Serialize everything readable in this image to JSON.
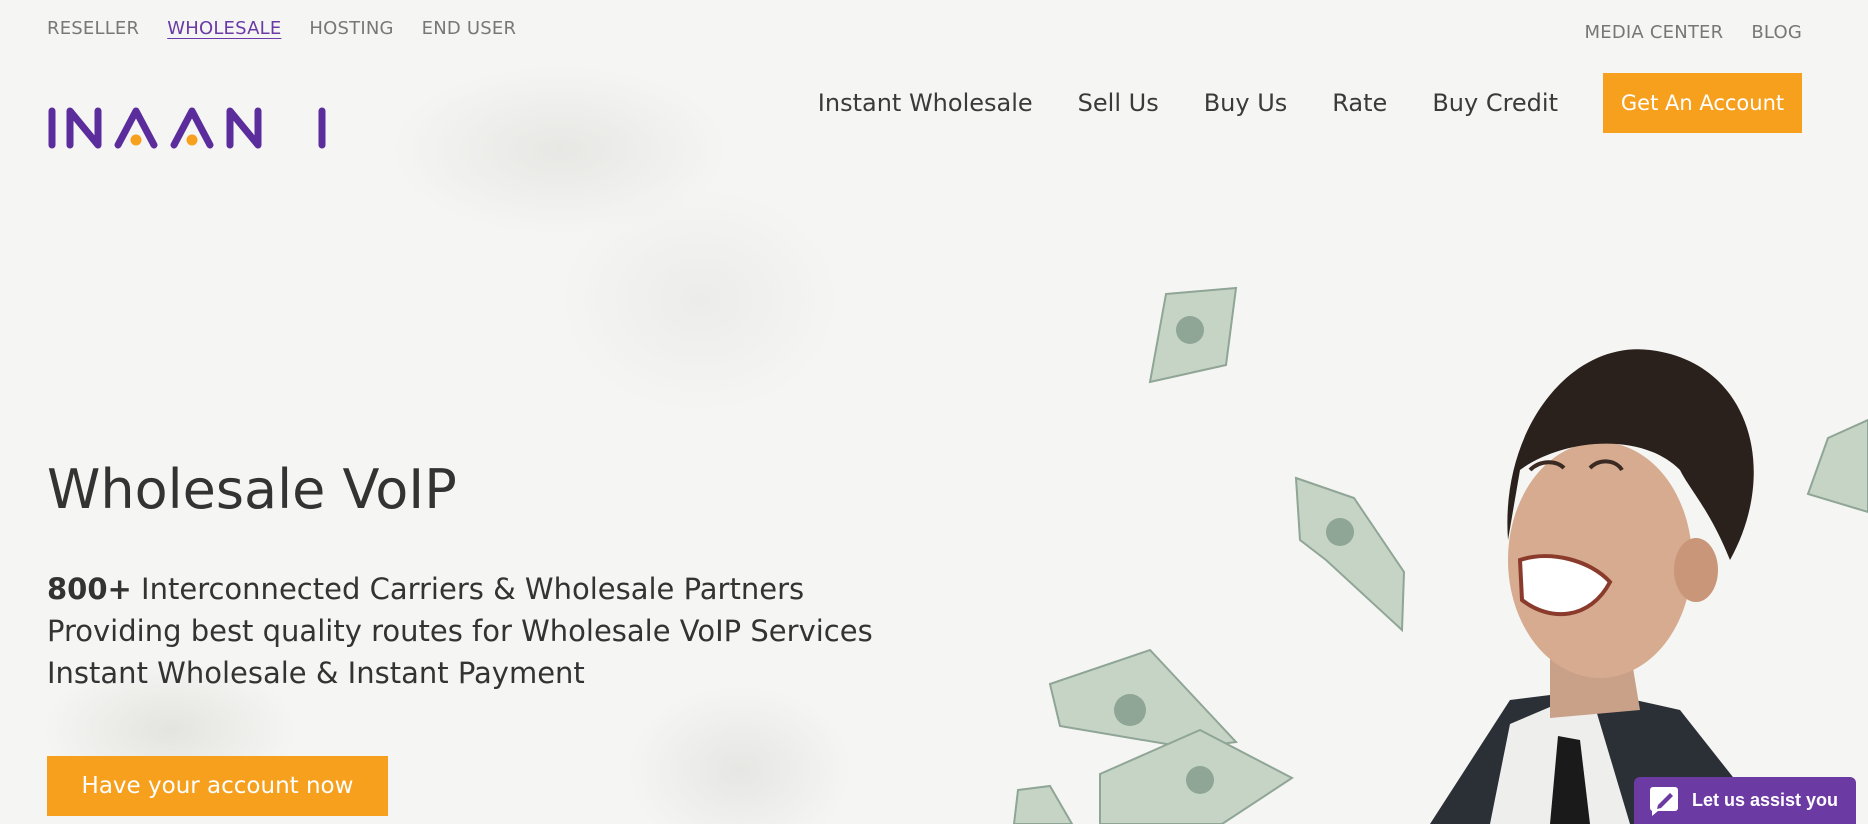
{
  "topbar": {
    "items": [
      {
        "label": "RESELLER"
      },
      {
        "label": "WHOLESALE"
      },
      {
        "label": "HOSTING"
      },
      {
        "label": "END USER"
      }
    ],
    "active": "WHOLESALE"
  },
  "toplinks": {
    "media_center": "MEDIA CENTER",
    "blog": "BLOG"
  },
  "logo": {
    "text": "INAANI",
    "brand_color": "#5b2d9c",
    "dot_color": "#f6a01e"
  },
  "nav": {
    "items": [
      {
        "label": "Instant Wholesale"
      },
      {
        "label": "Sell Us"
      },
      {
        "label": "Buy Us"
      },
      {
        "label": "Rate"
      },
      {
        "label": "Buy Credit"
      }
    ],
    "cta": "Get An Account"
  },
  "hero": {
    "title": "Wholesale VoIP",
    "line1_strong": "800+",
    "line1_rest": " Interconnected Carriers & Wholesale Partners",
    "line2": "Providing best quality routes for Wholesale VoIP Services",
    "line3": "Instant Wholesale & Instant Payment",
    "cta": "Have your account now"
  },
  "chat": {
    "label": "Let us assist you",
    "icon": "chat-pencil-icon"
  },
  "colors": {
    "accent": "#f6a01e",
    "brand": "#6a3aa8",
    "background": "#f5f5f3"
  }
}
